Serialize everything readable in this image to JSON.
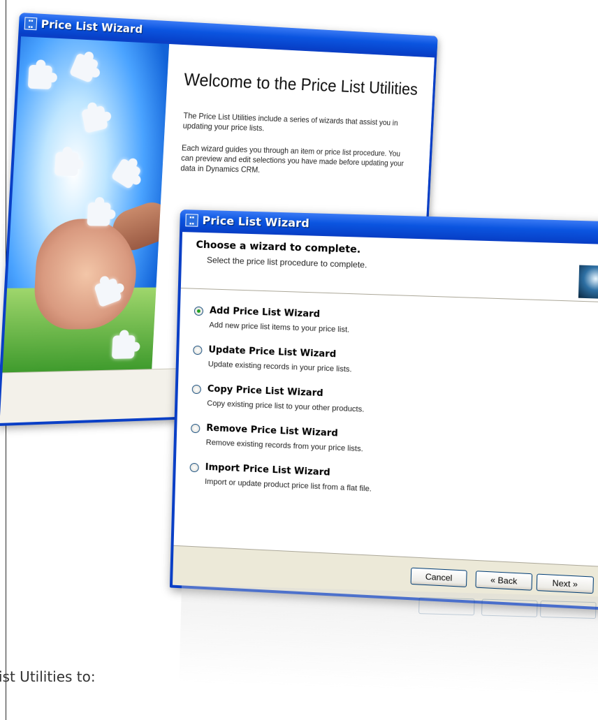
{
  "back_window": {
    "title": "Price List Wizard",
    "welcome_title": "Welcome to the Price List Utilities",
    "paragraph1": "The Price List Utilities include a series of wizards that assist you in updating your price lists.",
    "paragraph2": "Each wizard guides you through an item or price list procedure. You can preview and edit selections you have made before updating your data in Dynamics CRM."
  },
  "front_window": {
    "title": "Price List Wizard",
    "heading": "Choose a wizard to complete.",
    "subheading": "Select the price list procedure to complete.",
    "options": [
      {
        "title": "Add Price List Wizard",
        "desc": "Add new price list items to your price list.",
        "checked": true
      },
      {
        "title": "Update Price List Wizard",
        "desc": "Update existing records in your price lists.",
        "checked": false
      },
      {
        "title": "Copy Price List Wizard",
        "desc": "Copy existing price list to your other products.",
        "checked": false
      },
      {
        "title": "Remove Price List Wizard",
        "desc": "Remove existing records from your price lists.",
        "checked": false
      },
      {
        "title": "Import Price List Wizard",
        "desc": "Import or update product price list from a flat file.",
        "checked": false
      }
    ],
    "buttons": {
      "cancel": "Cancel",
      "back": "« Back",
      "next": "Next »"
    }
  },
  "page": {
    "bottom_text": "ist Utilities to:"
  },
  "colors": {
    "titlebar": "#0b55e0",
    "client": "#ece9d8",
    "radio_dot": "#21a121"
  },
  "icons": [
    "app-icon",
    "minimize-icon",
    "maximize-icon",
    "close-icon",
    "cursor-icon"
  ]
}
